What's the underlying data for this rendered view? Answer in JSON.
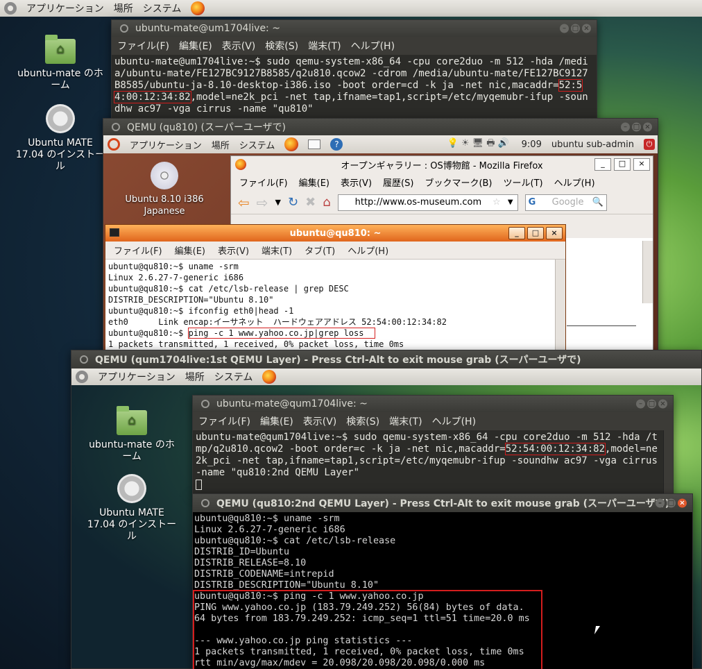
{
  "top_panel": {
    "menu_apps": "アプリケーション",
    "menu_places": "場所",
    "menu_system": "システム"
  },
  "desktop_icons": [
    {
      "label": "ubuntu-mate のホーム"
    },
    {
      "label": "Ubuntu MATE 17.04 のインストール"
    }
  ],
  "win1": {
    "title": "ubuntu-mate@um1704live: ~",
    "menu": [
      "ファイル(F)",
      "編集(E)",
      "表示(V)",
      "検索(S)",
      "端末(T)",
      "ヘルプ(H)"
    ],
    "cmd_pre": "ubuntu-mate@um1704live:~$ sudo qemu-system-x86_64 -cpu core2duo -m 512 -hda /media/ubuntu-mate/FE127BC9127B8585/q2u810.qcow2 -cdrom /media/ubuntu-mate/FE127BC9127B8585/ubuntu-ja-8.10-desktop-i386.iso -boot order=cd -k ja -net nic,macaddr=",
    "mac": "52:54:00:12:34:82",
    "cmd_post": ",model=ne2k_pci -net tap,ifname=tap1,script=/etc/myqemubr-ifup -soundhw ac97 -vga cirrus -name \"qu810\""
  },
  "win2": {
    "title": "QEMU (qu810) (スーパーユーザで)",
    "panel": {
      "apps": "アプリケーション",
      "places": "場所",
      "system": "システム",
      "time": "9:09",
      "user": "ubuntu sub-admin"
    },
    "cd_icon": {
      "label": "Ubuntu 8.10 i386 Japanese"
    },
    "firefox": {
      "title": "オープンギャラリー : OS博物館 - Mozilla Firefox",
      "menu": [
        "ファイル(F)",
        "編集(E)",
        "表示(V)",
        "履歴(S)",
        "ブックマーク(B)",
        "ツール(T)",
        "ヘルプ(H)"
      ],
      "url": "http://www.os-museum.com",
      "search_placeholder": "Google"
    },
    "term": {
      "title": "ubuntu@qu810: ~",
      "menu": [
        "ファイル(F)",
        "編集(E)",
        "表示(V)",
        "端末(T)",
        "タブ(T)",
        "ヘルプ(H)"
      ],
      "lines": [
        "ubuntu@qu810:~$ uname -srm",
        "Linux 2.6.27-7-generic i686",
        "ubuntu@qu810:~$ cat /etc/lsb-release | grep DESC",
        "DISTRIB_DESCRIPTION=\"Ubuntu 8.10\"",
        "ubuntu@qu810:~$ ifconfig eth0|head -1",
        "eth0      Link encap:イーサネット  ハードウェアアドレス 52:54:00:12:34:82"
      ],
      "prompt": "ubuntu@qu810:~$ ",
      "hl_cmd": "ping -c 1 www.yahoo.co.jp|grep loss",
      "result": "1 packets transmitted, 1 received, 0% packet loss, time 0ms"
    }
  },
  "win3": {
    "title": "QEMU (qum1704live:1st QEMU Layer) - Press Ctrl-Alt to exit mouse grab (スーパーユーザで)",
    "panel": {
      "apps": "アプリケーション",
      "places": "場所",
      "system": "システム"
    },
    "icons": [
      {
        "label": "ubuntu-mate のホーム"
      },
      {
        "label": "Ubuntu MATE 17.04 のインストール"
      }
    ],
    "term": {
      "title": "ubuntu-mate@qum1704live: ~",
      "menu": [
        "ファイル(F)",
        "編集(E)",
        "表示(V)",
        "検索(S)",
        "端末(T)",
        "ヘルプ(H)"
      ],
      "cmd_pre": "ubuntu-mate@qum1704live:~$ sudo qemu-system-x86_64 -cpu core2duo -m 512 -hda /tmp/q2u810.qcow2 -boot order=c -k ja -net nic,macaddr=",
      "mac": "52:54:00:12:34:82",
      "cmd_post": ",model=ne2k_pci -net tap,ifname=tap1,script=/etc/myqemubr-ifup -soundhw ac97 -vga cirrus -name \"qu810:2nd QEMU Layer\""
    },
    "inner": {
      "title": "QEMU (qu810:2nd QEMU Layer) - Press Ctrl-Alt to exit mouse grab (スーパーユーザで)",
      "lines": [
        "ubuntu@qu810:~$ uname -srm",
        "Linux 2.6.27-7-generic i686",
        "ubuntu@qu810:~$ cat /etc/lsb-release",
        "DISTRIB_ID=Ubuntu",
        "DISTRIB_RELEASE=8.10",
        "DISTRIB_CODENAME=intrepid",
        "DISTRIB_DESCRIPTION=\"Ubuntu 8.10\""
      ],
      "hl_lines": [
        "ubuntu@qu810:~$ ping -c 1 www.yahoo.co.jp",
        "PING www.yahoo.co.jp (183.79.249.252) 56(84) bytes of data.",
        "64 bytes from 183.79.249.252: icmp_seq=1 ttl=51 time=20.0 ms",
        "",
        "--- www.yahoo.co.jp ping statistics ---",
        "1 packets transmitted, 1 received, 0% packet loss, time 0ms",
        "rtt min/avg/max/mdev = 20.098/20.098/20.098/0.000 ms"
      ]
    }
  },
  "colors": {
    "highlight": "#d41d1d",
    "titlebar_dark": "#3c3b37",
    "old_orange": "#e0651c"
  }
}
